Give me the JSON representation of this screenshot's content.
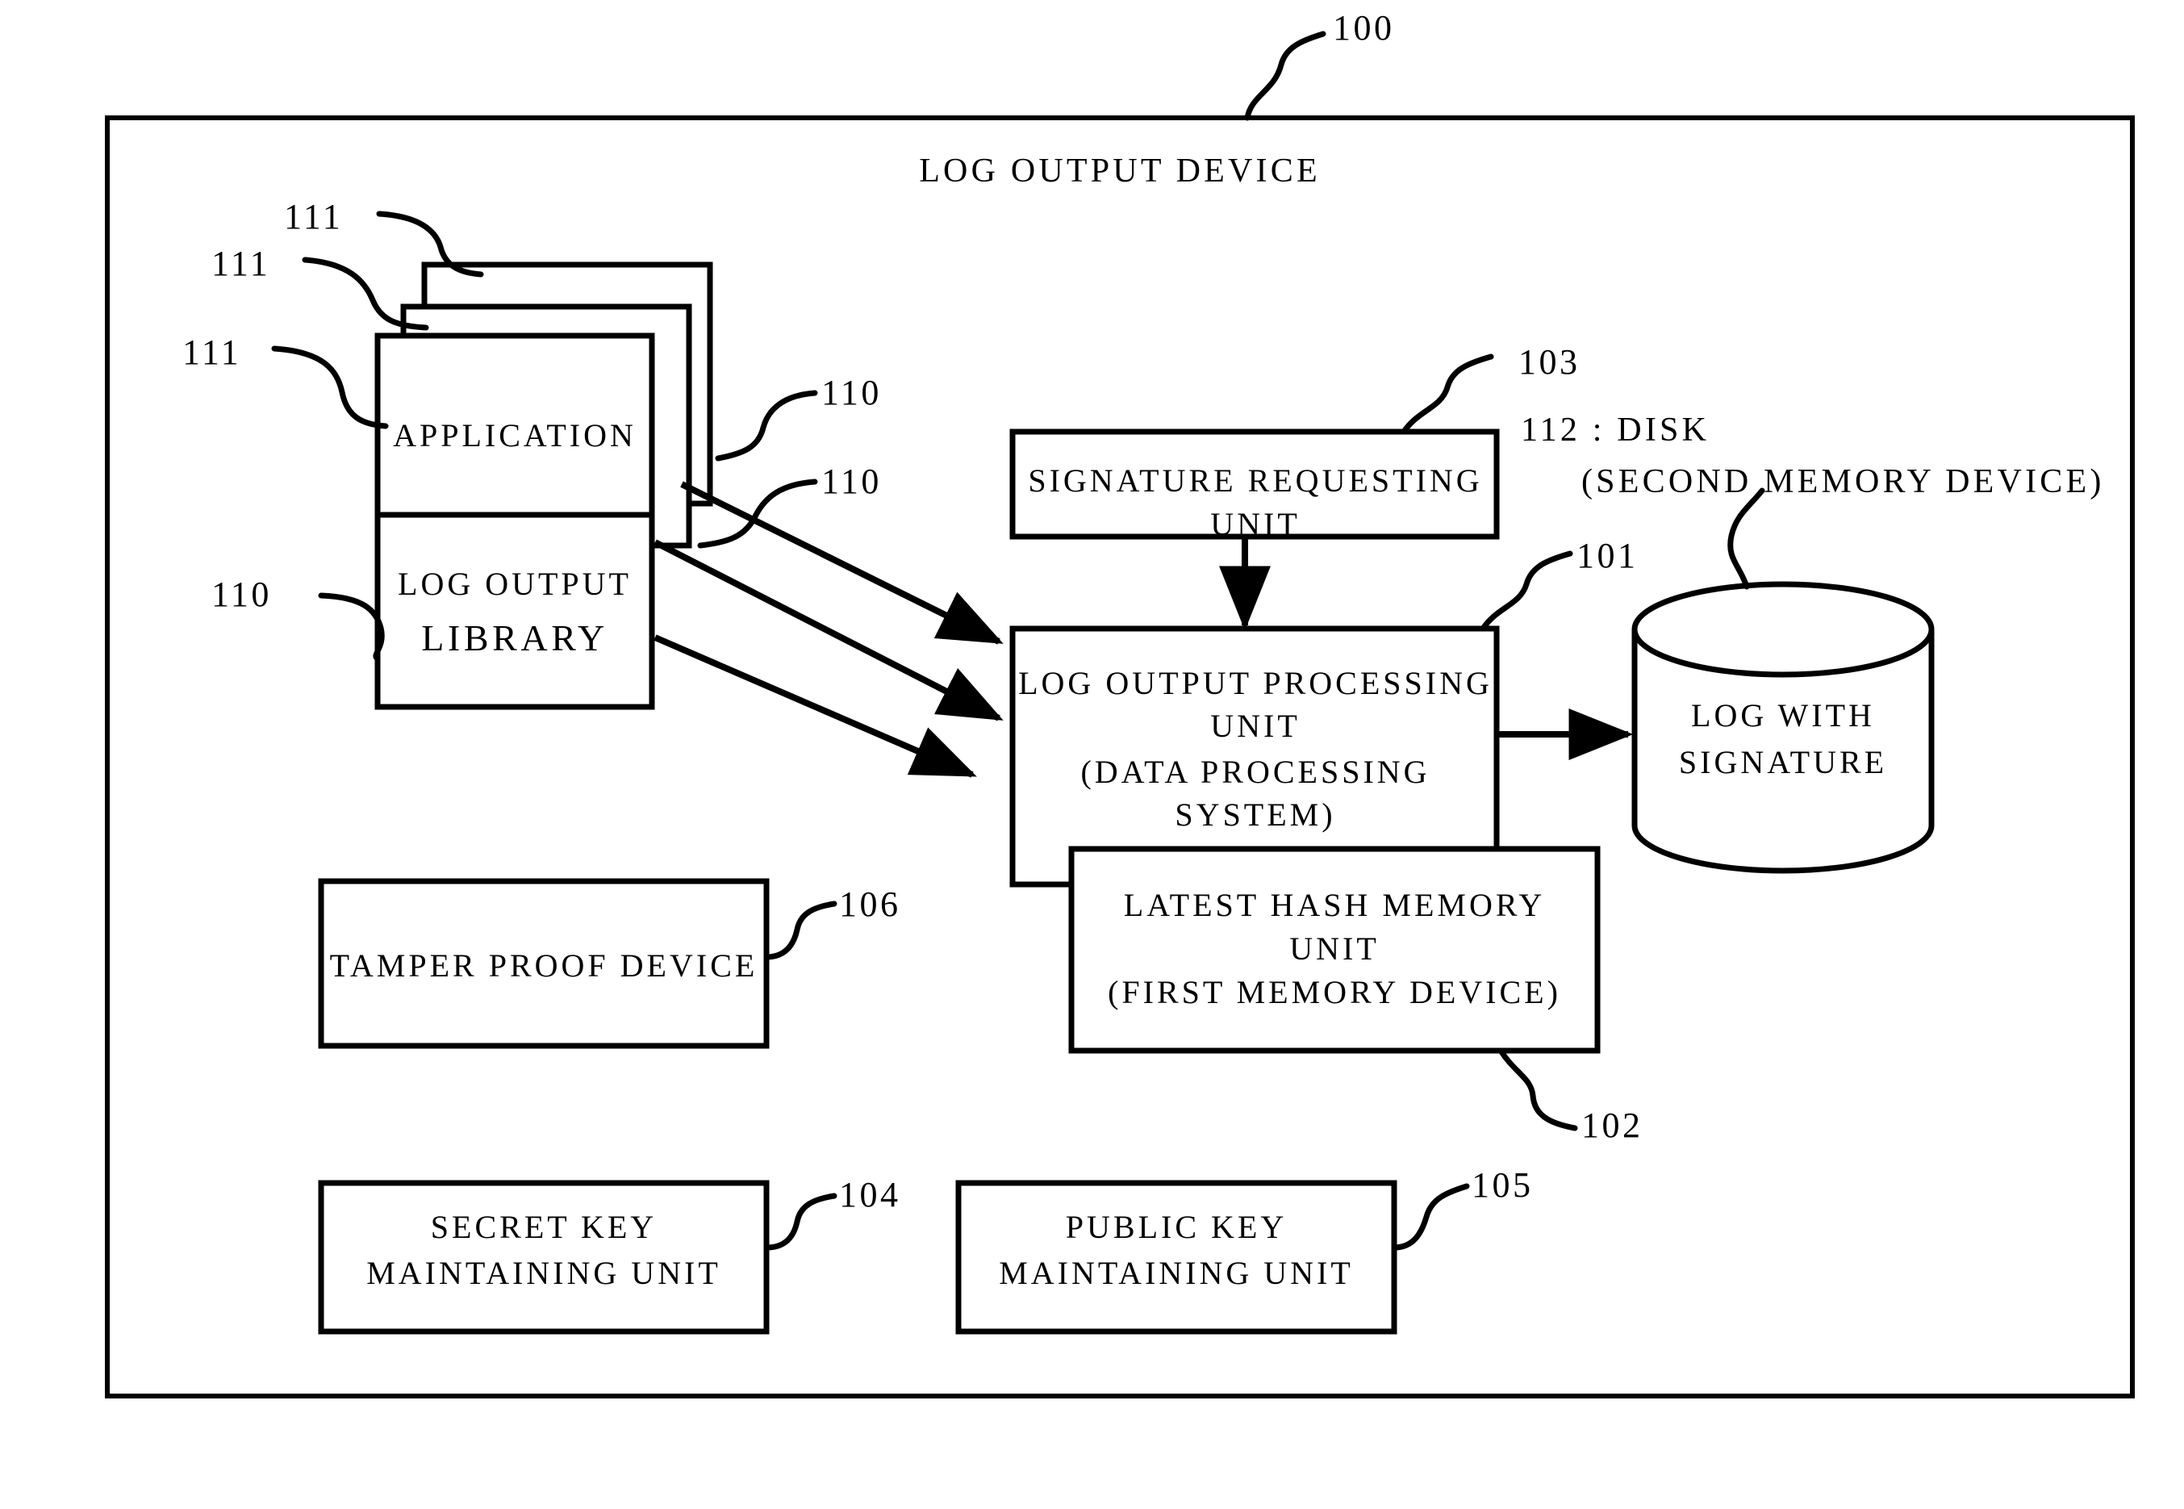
{
  "figure": {
    "type": "patent-block-diagram",
    "device_title": "LOG OUTPUT DEVICE",
    "device_ref": "100"
  },
  "blocks": {
    "application": {
      "label": "APPLICATION",
      "ref": "111",
      "stack_count": 3
    },
    "log_output_library": {
      "line1": "LOG OUTPUT",
      "line2": "LIBRARY",
      "ref": "110"
    },
    "signature_requesting_unit": {
      "line1": "SIGNATURE REQUESTING",
      "line2": "UNIT",
      "ref": "103"
    },
    "log_output_processing_unit": {
      "line1": "LOG OUTPUT PROCESSING",
      "line2": "UNIT",
      "line3": "(DATA PROCESSING",
      "line4": "SYSTEM)",
      "ref": "101"
    },
    "latest_hash_memory_unit": {
      "line1": "LATEST HASH MEMORY",
      "line2": "UNIT",
      "line3": "(FIRST MEMORY DEVICE)",
      "ref": "102"
    },
    "disk": {
      "caption_line1": "112 : DISK",
      "caption_line2": "(SECOND MEMORY DEVICE)",
      "content_line1": "LOG WITH",
      "content_line2": "SIGNATURE"
    },
    "tamper_proof_device": {
      "label": "TAMPER PROOF DEVICE",
      "ref": "106"
    },
    "secret_key_maintaining_unit": {
      "line1": "SECRET KEY",
      "line2": "MAINTAINING UNIT",
      "ref": "104"
    },
    "public_key_maintaining_unit": {
      "line1": "PUBLIC KEY",
      "line2": "MAINTAINING UNIT",
      "ref": "105"
    }
  },
  "reference_numerals": {
    "device": "100",
    "processing_unit": "101",
    "hash_memory": "102",
    "signature_requesting": "103",
    "secret_key": "104",
    "public_key": "105",
    "tamper_proof": "106",
    "library_1": "110",
    "library_2": "110",
    "library_3": "110",
    "application_1": "111",
    "application_2": "111",
    "application_3": "111",
    "disk": "112"
  },
  "colors": {
    "ink": "#000000",
    "paper": "#ffffff"
  }
}
